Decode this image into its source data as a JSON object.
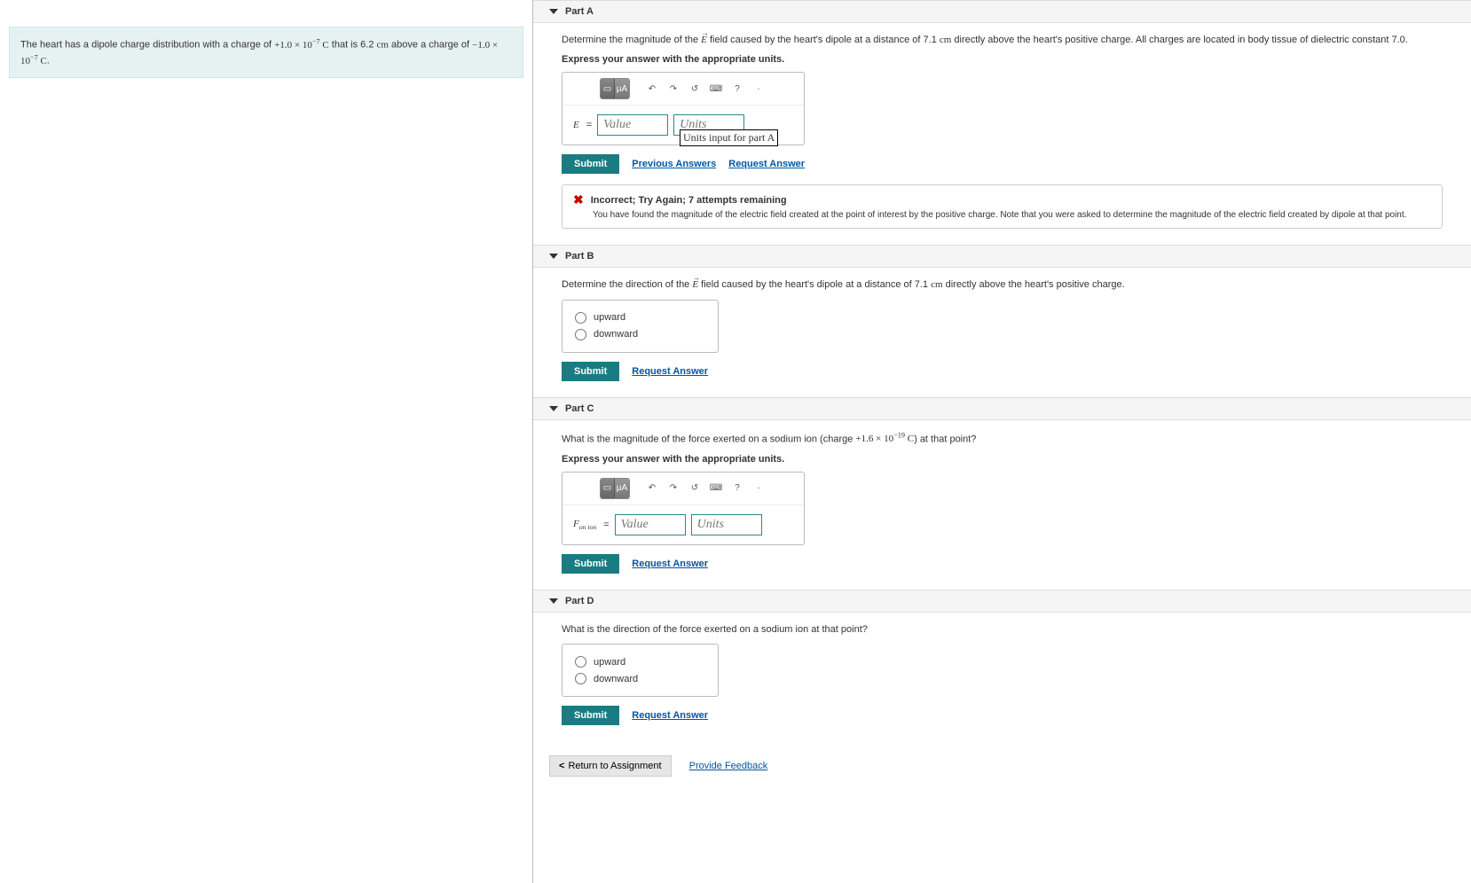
{
  "problem": {
    "text_pre": "The heart has a dipole charge distribution with a charge of ",
    "charge_pos": "+1.0 × 10",
    "charge_pos_exp": "−7",
    "charge_pos_unit": "C",
    "text_mid1": " that is 6.2 ",
    "dist_unit": "cm",
    "text_mid2": " above a charge of ",
    "charge_neg": "−1.0 × 10",
    "charge_neg_exp": "−7",
    "charge_neg_unit": "C",
    "text_end": "."
  },
  "parts": {
    "a": {
      "title": "Part A",
      "prompt_pre": "Determine the magnitude of the ",
      "prompt_vec": "E",
      "prompt_post": " field caused by the heart's dipole at a distance of 7.1 ",
      "prompt_unit": "cm",
      "prompt_post2": " directly above the heart's positive charge. All charges are located in body tissue of dielectric constant 7.0.",
      "express": "Express your answer with the appropriate units.",
      "var_label": "E",
      "equals": "=",
      "value_ph": "Value",
      "units_ph": "Units",
      "tooltip": "Units input for part A",
      "submit": "Submit",
      "prev_answers": "Previous Answers",
      "request_answer": "Request Answer",
      "feedback": {
        "title": "Incorrect; Try Again; 7 attempts remaining",
        "text": "You have found the magnitude of the electric field created at the point of interest by the positive charge. Note that you were asked to determine the magnitude of the electric field created by dipole at that point."
      }
    },
    "b": {
      "title": "Part B",
      "prompt_pre": "Determine the direction of the ",
      "prompt_vec": "E",
      "prompt_post": " field caused by the heart's dipole at a distance of 7.1 ",
      "prompt_unit": "cm",
      "prompt_post2": " directly above the heart's positive charge.",
      "opt1": "upward",
      "opt2": "downward",
      "submit": "Submit",
      "request_answer": "Request Answer"
    },
    "c": {
      "title": "Part C",
      "prompt_pre": "What is the magnitude of the force exerted on a sodium ion (charge ",
      "ion_charge": "+1.6 × 10",
      "ion_charge_exp": "−19",
      "ion_charge_unit": "C",
      "prompt_post": ") at that point?",
      "express": "Express your answer with the appropriate units.",
      "var_label": "F",
      "var_sub": "on ion",
      "equals": "=",
      "value_ph": "Value",
      "units_ph": "Units",
      "submit": "Submit",
      "request_answer": "Request Answer"
    },
    "d": {
      "title": "Part D",
      "prompt": "What is the direction of the force exerted on a sodium ion at that point?",
      "opt1": "upward",
      "opt2": "downward",
      "submit": "Submit",
      "request_answer": "Request Answer"
    }
  },
  "footer": {
    "return": "Return to Assignment",
    "feedback_link": "Provide Feedback"
  },
  "toolbar_icons": {
    "templates": "▭",
    "greek": "μA",
    "undo": "↶",
    "redo": "↷",
    "reset": "↺",
    "keyboard": "⌨",
    "help": "?",
    "more": "·"
  }
}
